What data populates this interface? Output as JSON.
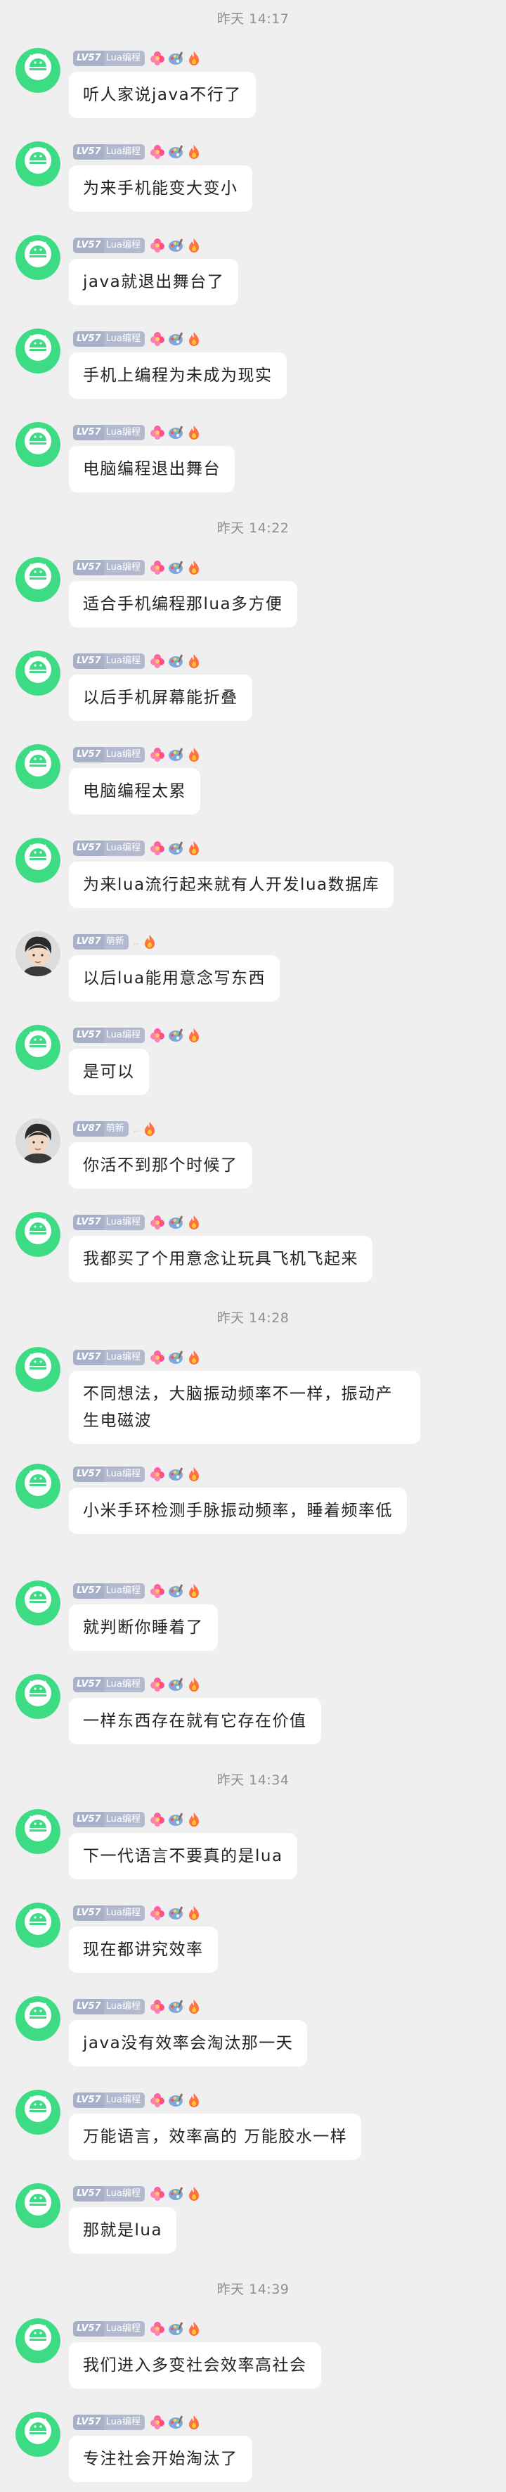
{
  "user_lua": {
    "badge_level": "LV57",
    "badge_title": "Lua编程"
  },
  "user_new": {
    "badge_level": "LV87",
    "badge_title": "萌新",
    "dots": ".."
  },
  "timestamps": [
    "昨天 14:17",
    "昨天 14:22",
    "昨天 14:28",
    "昨天 14:34",
    "昨天 14:39"
  ],
  "messages": [
    {
      "text": "听人家说java不行了"
    },
    {
      "text": "为来手机能变大变小"
    },
    {
      "text": "java就退出舞台了"
    },
    {
      "text": "手机上编程为未成为现实"
    },
    {
      "text": "电脑编程退出舞台"
    },
    {
      "text": "适合手机编程那lua多方便"
    },
    {
      "text": "以后手机屏幕能折叠"
    },
    {
      "text": "电脑编程太累"
    },
    {
      "text": "为来lua流行起来就有人开发lua数据库"
    },
    {
      "text": "以后lua能用意念写东西"
    },
    {
      "text": "是可以"
    },
    {
      "text": "你活不到那个时候了"
    },
    {
      "text": "我都买了个用意念让玩具飞机飞起来"
    },
    {
      "text": "不同想法，大脑振动频率不一样，振动产生电磁波"
    },
    {
      "text": "小米手环检测手脉振动频率，睡着频率低"
    },
    {
      "text": "就判断你睡着了"
    },
    {
      "text": "一样东西存在就有它存在价值"
    },
    {
      "text": "下一代语言不要真的是lua"
    },
    {
      "text": "现在都讲究效率"
    },
    {
      "text": "java没有效率会淘汰那一天"
    },
    {
      "text": "万能语言，效率高的 万能胶水一样"
    },
    {
      "text": "那就是lua"
    },
    {
      "text": "我们进入多变社会效率高社会"
    },
    {
      "text": "专注社会开始淘汰了"
    }
  ],
  "colors": {
    "background": "#efefef",
    "bubble": "#ffffff",
    "android_avatar_bg": "#3ddc84",
    "badge_lv": "#a8b0c8",
    "badge_title": "#b3b9cf",
    "timestamp_text": "#8f8f8f"
  },
  "icons": [
    "android-avatar-icon",
    "person-avatar-icon",
    "pink-flower-icon",
    "palette-icon",
    "fire-icon"
  ]
}
